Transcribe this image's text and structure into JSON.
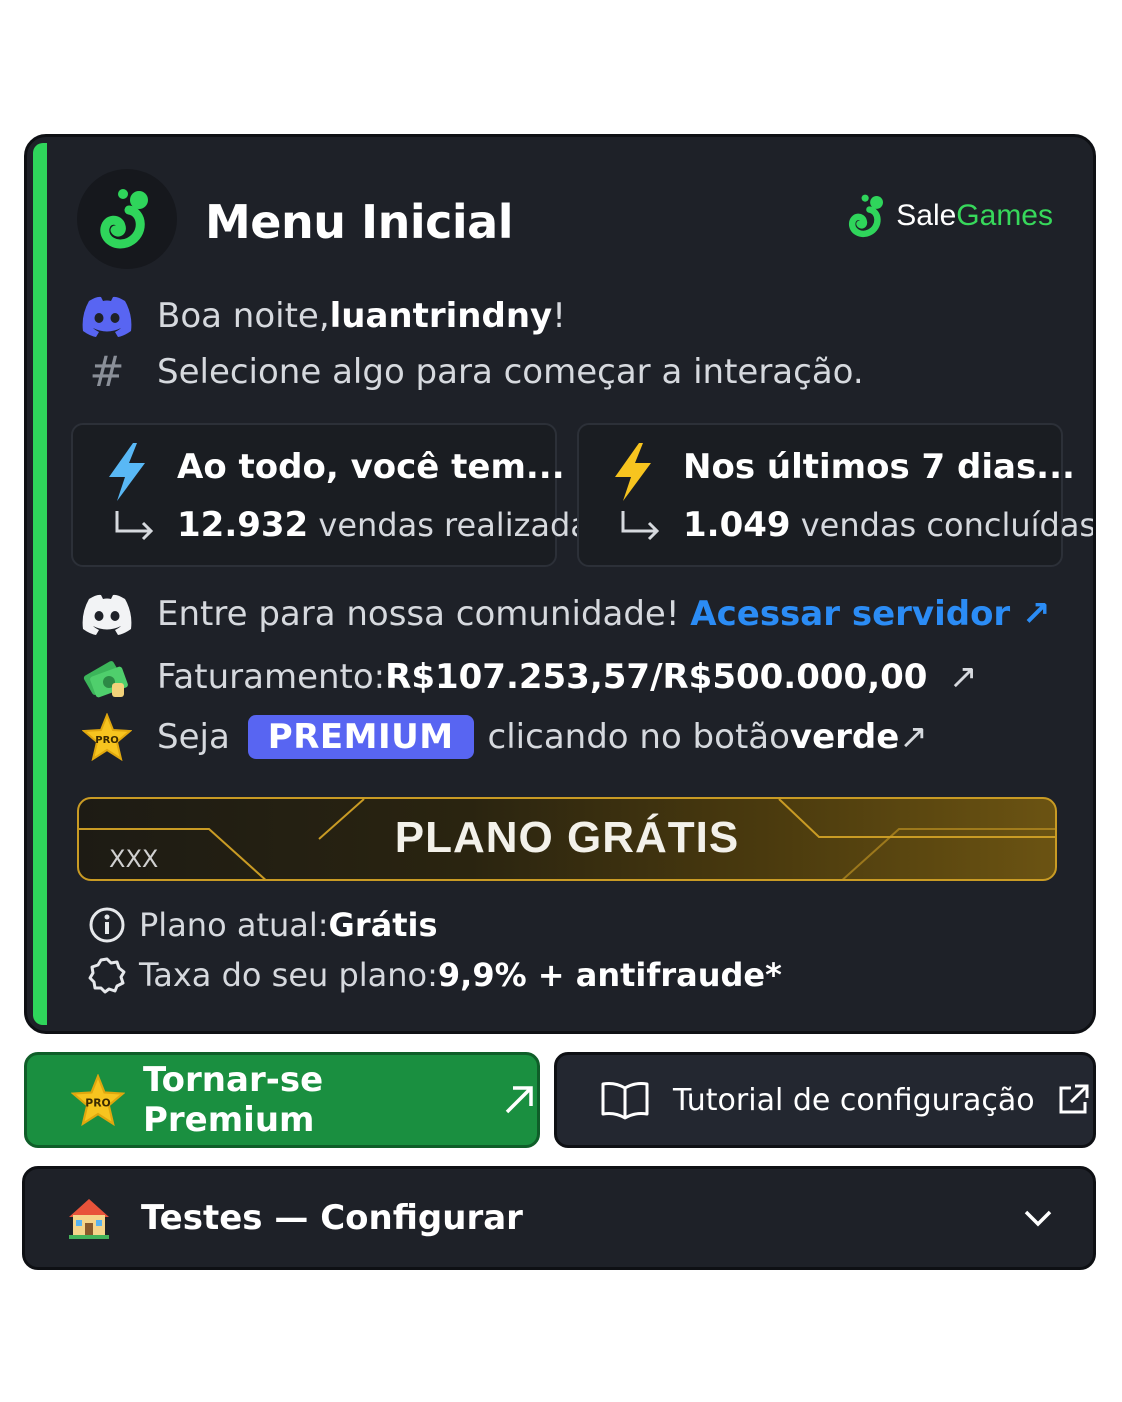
{
  "header": {
    "title": "Menu Inicial",
    "brand_sale": "Sale",
    "brand_games": "Games",
    "accent_color": "#2fd55b"
  },
  "greeting": {
    "prefix": "Boa noite, ",
    "username": "luantrindny",
    "suffix": "!",
    "subtitle": "Selecione algo para começar a interação."
  },
  "stats": [
    {
      "title": "Ao todo, você tem...",
      "value": "12.932",
      "label": "vendas realizadas",
      "icon": "lightning-blue-icon"
    },
    {
      "title": "Nos últimos 7 dias...",
      "value": "1.049",
      "label": "vendas concluídas",
      "icon": "lightning-yellow-icon"
    }
  ],
  "community": {
    "text": "Entre para nossa comunidade!",
    "link": "Acessar servidor ↗"
  },
  "revenue": {
    "label": "Faturamento: ",
    "current": "R$107.253,57",
    "separator": " / ",
    "goal": "R$500.000,00",
    "arrow": "↗"
  },
  "premium_line": {
    "prefix": "Seja",
    "badge": "PREMIUM",
    "middle": "clicando no botão ",
    "bold": "verde",
    "arrow": " ↗"
  },
  "plan_banner": {
    "title": "PLANO GRÁTIS",
    "tag": "XXX"
  },
  "plan_info": {
    "current_label": "Plano atual: ",
    "current_value": "Grátis",
    "fee_label": "Taxa do seu plano: ",
    "fee_value": "9,9% + antifraude*"
  },
  "buttons": {
    "premium": "Tornar-se Premium",
    "tutorial": "Tutorial de configuração",
    "pro_badge": "PRO"
  },
  "select": {
    "label": "Testes — Configurar",
    "icon": "house-icon"
  }
}
